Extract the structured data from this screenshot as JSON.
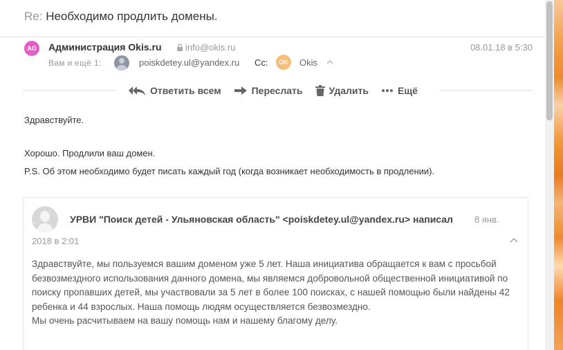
{
  "subject": {
    "prefix": "Re:",
    "text": "Необходимо продлить домены."
  },
  "sender": {
    "avatar_initials": "АО",
    "name": "Администрация Okis.ru",
    "email": "info@okis.ru",
    "date": "08.01.18 в 5:30"
  },
  "recipients": {
    "label": "Вам и ещё 1:",
    "to_email": "poiskdetey.ul@yandex.ru",
    "cc_label": "Cc:",
    "cc_avatar_initials": "OK",
    "cc_name": "Okis"
  },
  "toolbar": {
    "reply_all": "Ответить всем",
    "forward": "Переслать",
    "delete": "Удалить",
    "more": "Ещё"
  },
  "body": {
    "greeting": "Здравствуйте.",
    "line1": "Хорошо. Продлили ваш домен.",
    "line2": "P.S. Об этом необходимо будет писать каждый год (когда возникает необходимость в продлении)."
  },
  "quote": {
    "header": "УРВИ \"Поиск детей - Ульяновская область\" <poiskdetey.ul@yandex.ru> написал",
    "date_part1": "8 янв.",
    "date_part2": "2018 в 2:01",
    "paragraph1": "Здравствуйте, мы пользуемся вашим доменом уже 5 лет. Наша инициатива обращается к вам с просьбой безвозмездного использования данного домена, мы являемся добровольной общественной инициативой по поиску пропавших детей, мы участвовали за 5 лет в более 100 поисках, с нашей помощью были найдены 42 ребенка и 44 взрослых. Наша помощь людям осуществляется безвозмездно.",
    "paragraph2": "Мы очень расчитываем на вашу помощь нам и нашему благому делу."
  },
  "colors": {
    "avatar_ao": "#e25ec3",
    "avatar_ok": "#f7be7b",
    "text_muted": "#999999"
  }
}
